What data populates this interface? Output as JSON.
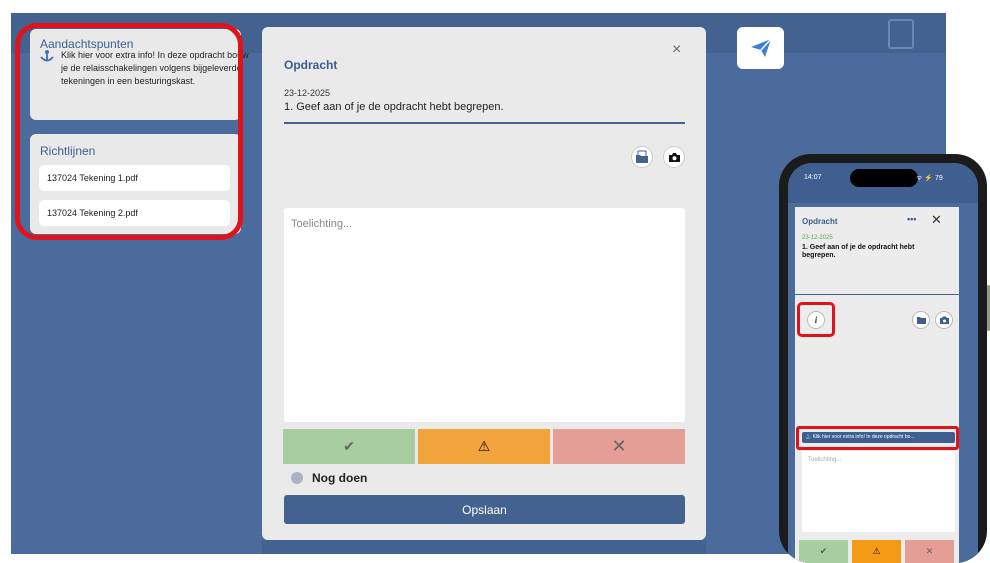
{
  "sidebar": {
    "aandachtspunten": {
      "title": "Aandachtspunten",
      "icon": "anchor-icon",
      "text": "Klik hier voor extra info! In deze opdracht bouw je de relaisschakelingen volgens bijgeleverde tekeningen in een besturingskast."
    },
    "richtlijnen": {
      "title": "Richtlijnen",
      "files": [
        "137024 Tekening 1.pdf",
        "137024 Tekening 2.pdf"
      ]
    }
  },
  "modal": {
    "title": "Opdracht",
    "close": "×",
    "date": "23-12-2025",
    "question": "1. Geef aan of je de opdracht hebt begrepen.",
    "comment_placeholder": "Toelichting...",
    "status_label": "Nog doen",
    "save_label": "Opslaan",
    "buttons": {
      "ok": {
        "symbol": "✔",
        "color": "#a8cda1"
      },
      "warning": {
        "symbol": "⚠",
        "color": "#f1a43c"
      },
      "reject": {
        "symbol": "✕",
        "color": "#e49e96"
      }
    }
  },
  "phone": {
    "time": "14:07",
    "status_icons": "ᯤ ⚡ 79",
    "title": "Opdracht",
    "menu": "•••",
    "close": "✕",
    "date": "23-12-2025",
    "question": "1. Geef aan of je de opdracht hebt begrepen.",
    "info": "i",
    "banner": "Klik hier voor extra info! In deze opdracht bo...",
    "comment_placeholder": "Toelichting...",
    "buttons": {
      "ok": "✔",
      "warning": "⚠",
      "reject": "✕"
    }
  },
  "colors": {
    "brand": "#44628f",
    "background": "#4a6b9c",
    "highlight": "#e0131a"
  }
}
